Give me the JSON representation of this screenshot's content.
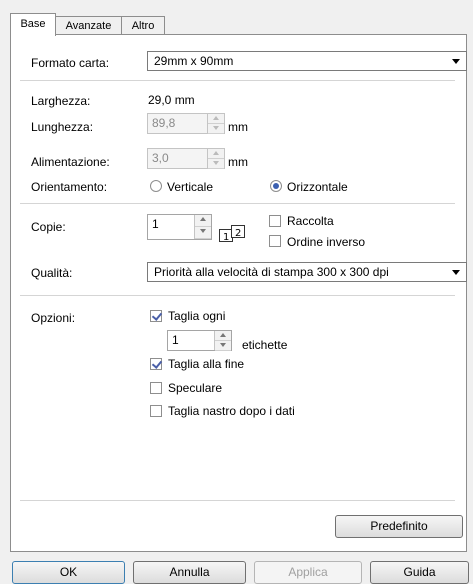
{
  "tabs": [
    "Base",
    "Avanzate",
    "Altro"
  ],
  "form": {
    "paper_format_label": "Formato carta:",
    "paper_format_value": "29mm x 90mm",
    "width_label": "Larghezza:",
    "width_value": "29,0 mm",
    "length_label": "Lunghezza:",
    "length_value": "89,8",
    "length_unit": "mm",
    "feed_label": "Alimentazione:",
    "feed_value": "3,0",
    "feed_unit": "mm",
    "orientation_label": "Orientamento:",
    "orientation_vertical": "Verticale",
    "orientation_horizontal": "Orizzontale",
    "copies_label": "Copie:",
    "copies_value": "1",
    "collate_label": "Raccolta",
    "reverse_order_label": "Ordine inverso",
    "quality_label": "Qualità:",
    "quality_value": "Priorità alla velocità di stampa 300 x 300 dpi",
    "options_label": "Opzioni:",
    "cut_every_label": "Taglia ogni",
    "cut_every_value": "1",
    "labels_unit": "etichette",
    "cut_at_end_label": "Taglia alla fine",
    "mirror_label": "Speculare",
    "cut_tape_after_label": "Taglia nastro dopo i dati",
    "default_button": "Predefinito"
  },
  "footer": {
    "ok": "OK",
    "cancel": "Annulla",
    "apply": "Applica",
    "help": "Guida"
  }
}
